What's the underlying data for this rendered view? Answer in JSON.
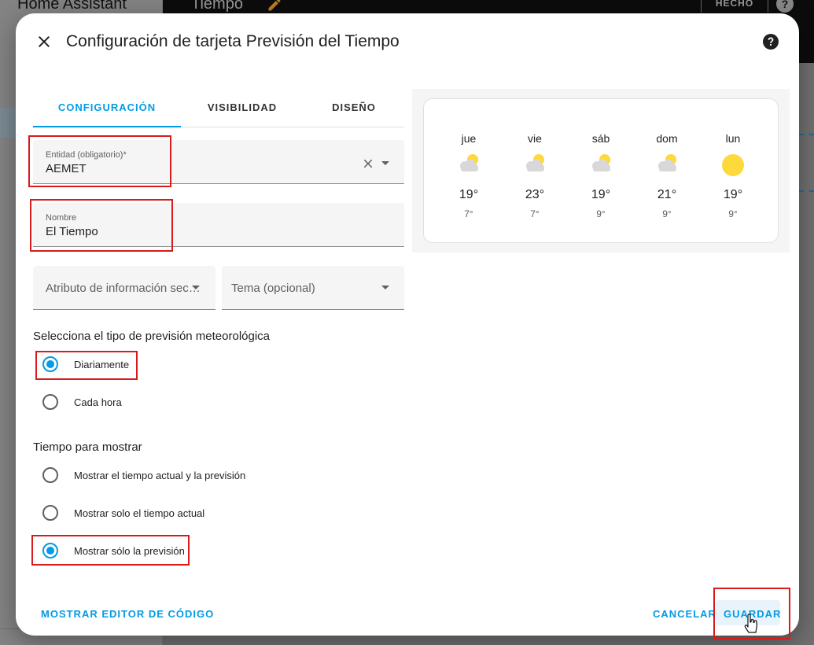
{
  "background": {
    "app_title": "Home Assistant",
    "header_title": "Tiempo",
    "done_label": "HECHO",
    "help_label": "?"
  },
  "dialog": {
    "title": "Configuración de tarjeta Previsión del Tiempo",
    "tabs": [
      {
        "label": "CONFIGURACIÓN",
        "active": true
      },
      {
        "label": "VISIBILIDAD",
        "active": false
      },
      {
        "label": "DISEÑO",
        "active": false
      }
    ],
    "entity_field": {
      "label": "Entidad (obligatorio)*",
      "value": "AEMET"
    },
    "name_field": {
      "label": "Nombre",
      "value": "El Tiempo"
    },
    "secondary_attr_placeholder": "Atributo de información secundaria",
    "theme_placeholder": "Tema (opcional)",
    "forecast_type": {
      "label": "Selecciona el tipo de previsión meteorológica",
      "options": [
        {
          "label": "Diariamente",
          "checked": true
        },
        {
          "label": "Cada hora",
          "checked": false
        }
      ]
    },
    "display": {
      "label": "Tiempo para mostrar",
      "options": [
        {
          "label": "Mostrar el tiempo actual y la previsión",
          "checked": false
        },
        {
          "label": "Mostrar solo el tiempo actual",
          "checked": false
        },
        {
          "label": "Mostrar sólo la previsión",
          "checked": true
        }
      ]
    },
    "footer": {
      "code_editor_label": "MOSTRAR EDITOR DE CÓDIGO",
      "cancel_label": "CANCELAR",
      "save_label": "GUARDAR"
    }
  },
  "preview": {
    "forecast": [
      {
        "day": "jue",
        "high": "19°",
        "low": "7°",
        "icon": "partly-cloudy-icon"
      },
      {
        "day": "vie",
        "high": "23°",
        "low": "7°",
        "icon": "partly-cloudy-icon"
      },
      {
        "day": "sáb",
        "high": "19°",
        "low": "9°",
        "icon": "partly-cloudy-icon"
      },
      {
        "day": "dom",
        "high": "21°",
        "low": "9°",
        "icon": "partly-cloudy-icon"
      },
      {
        "day": "lun",
        "high": "19°",
        "low": "9°",
        "icon": "sunny-icon"
      }
    ]
  },
  "colors": {
    "accent": "#039be5",
    "highlight": "#d81b1b",
    "sun": "#fdd93c",
    "cloud": "#d8d8d8"
  }
}
